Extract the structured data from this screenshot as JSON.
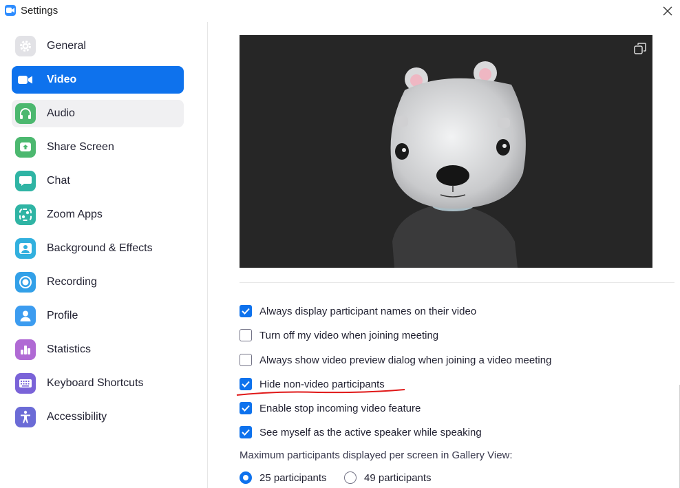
{
  "window": {
    "title": "Settings"
  },
  "sidebar": {
    "items": [
      {
        "label": "General",
        "icon": "gear-icon",
        "color": "#e0e0e3",
        "state": "normal"
      },
      {
        "label": "Video",
        "icon": "video-camera-icon",
        "color": "#0e72ed",
        "state": "active"
      },
      {
        "label": "Audio",
        "icon": "headphones-icon",
        "color": "#49b96c",
        "state": "hover"
      },
      {
        "label": "Share Screen",
        "icon": "share-screen-icon",
        "color": "#49b96c",
        "state": "normal"
      },
      {
        "label": "Chat",
        "icon": "chat-bubble-icon",
        "color": "#2fb4a4",
        "state": "normal"
      },
      {
        "label": "Zoom Apps",
        "icon": "zoom-apps-icon",
        "color": "#2fb4a4",
        "state": "normal"
      },
      {
        "label": "Background & Effects",
        "icon": "background-person-icon",
        "color": "#32b0de",
        "state": "normal"
      },
      {
        "label": "Recording",
        "icon": "record-icon",
        "color": "#32a0e8",
        "state": "normal"
      },
      {
        "label": "Profile",
        "icon": "person-icon",
        "color": "#3c9cf0",
        "state": "normal"
      },
      {
        "label": "Statistics",
        "icon": "bar-chart-icon",
        "color": "#b06ad4",
        "state": "normal"
      },
      {
        "label": "Keyboard Shortcuts",
        "icon": "keyboard-icon",
        "color": "#7a63d8",
        "state": "normal"
      },
      {
        "label": "Accessibility",
        "icon": "accessibility-icon",
        "color": "#6b6bd6",
        "state": "normal"
      }
    ]
  },
  "video": {
    "options": [
      {
        "label": "Always display participant names on their video",
        "checked": true
      },
      {
        "label": "Turn off my video when joining meeting",
        "checked": false
      },
      {
        "label": "Always show video preview dialog when joining a video meeting",
        "checked": false
      },
      {
        "label": "Hide non-video participants",
        "checked": true
      },
      {
        "label": "Enable stop incoming video feature",
        "checked": true
      },
      {
        "label": "See myself as the active speaker while speaking",
        "checked": true
      }
    ],
    "gallery_label": "Maximum participants displayed per screen in Gallery View:",
    "gallery_options": [
      {
        "label": "25 participants",
        "selected": true
      },
      {
        "label": "49 participants",
        "selected": false
      }
    ]
  }
}
